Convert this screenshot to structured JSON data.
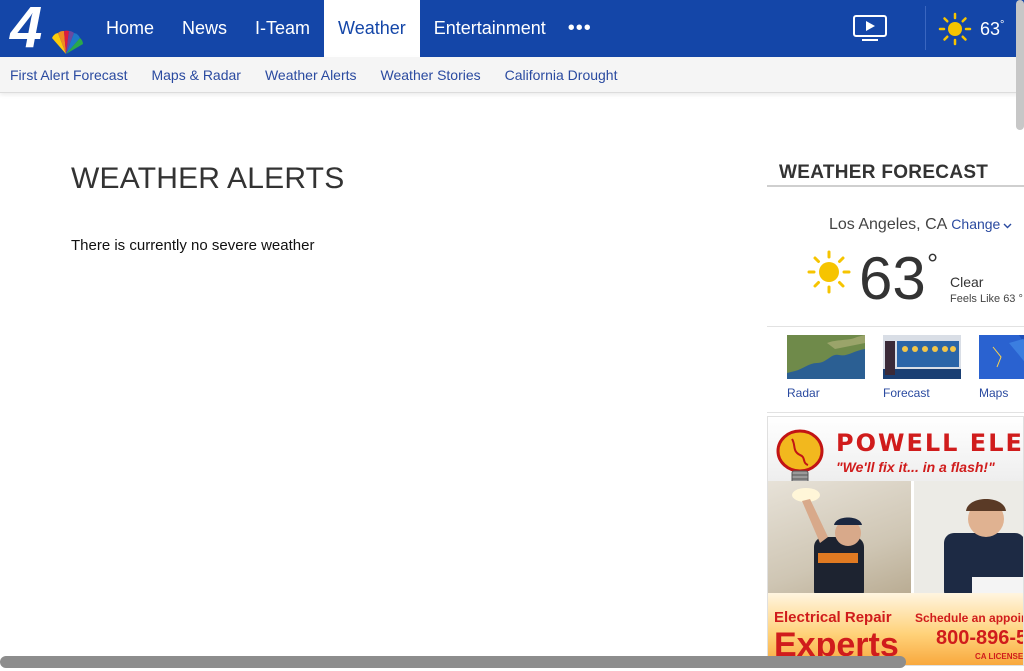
{
  "header": {
    "logo_text": "4",
    "nav": [
      {
        "label": "Home"
      },
      {
        "label": "News"
      },
      {
        "label": "I-Team"
      },
      {
        "label": "Weather"
      },
      {
        "label": "Entertainment"
      }
    ],
    "more_label": "•••",
    "temp": "63",
    "degree": "°"
  },
  "subnav": [
    {
      "label": "First Alert Forecast"
    },
    {
      "label": "Maps & Radar"
    },
    {
      "label": "Weather Alerts"
    },
    {
      "label": "Weather Stories"
    },
    {
      "label": "California Drought"
    }
  ],
  "main": {
    "title": "WEATHER ALERTS",
    "message": "There is currently no severe weather"
  },
  "forecast": {
    "title": "WEATHER FORECAST",
    "location": "Los Angeles, CA",
    "change_label": "Change",
    "temp": "63",
    "degree": "°",
    "condition": "Clear",
    "feels_like": "Feels Like 63 °",
    "thumbs": [
      {
        "label": "Radar"
      },
      {
        "label": "Forecast"
      },
      {
        "label": "Maps"
      }
    ]
  },
  "ad": {
    "brand": "POWELL ELECTRIC",
    "bulb_text": "POWELL ELECTRIC",
    "slogan": "\"We'll fix it... in a flash!\"",
    "repair": "Electrical Repair",
    "experts": "Experts",
    "schedule": "Schedule an appointment",
    "phone": "800-896-5",
    "license": "CA LICENSE"
  },
  "colors": {
    "nav_bg": "#1446a8",
    "link": "#2a4aa0",
    "ad_red": "#d01c1c",
    "sun": "#f6c400"
  }
}
